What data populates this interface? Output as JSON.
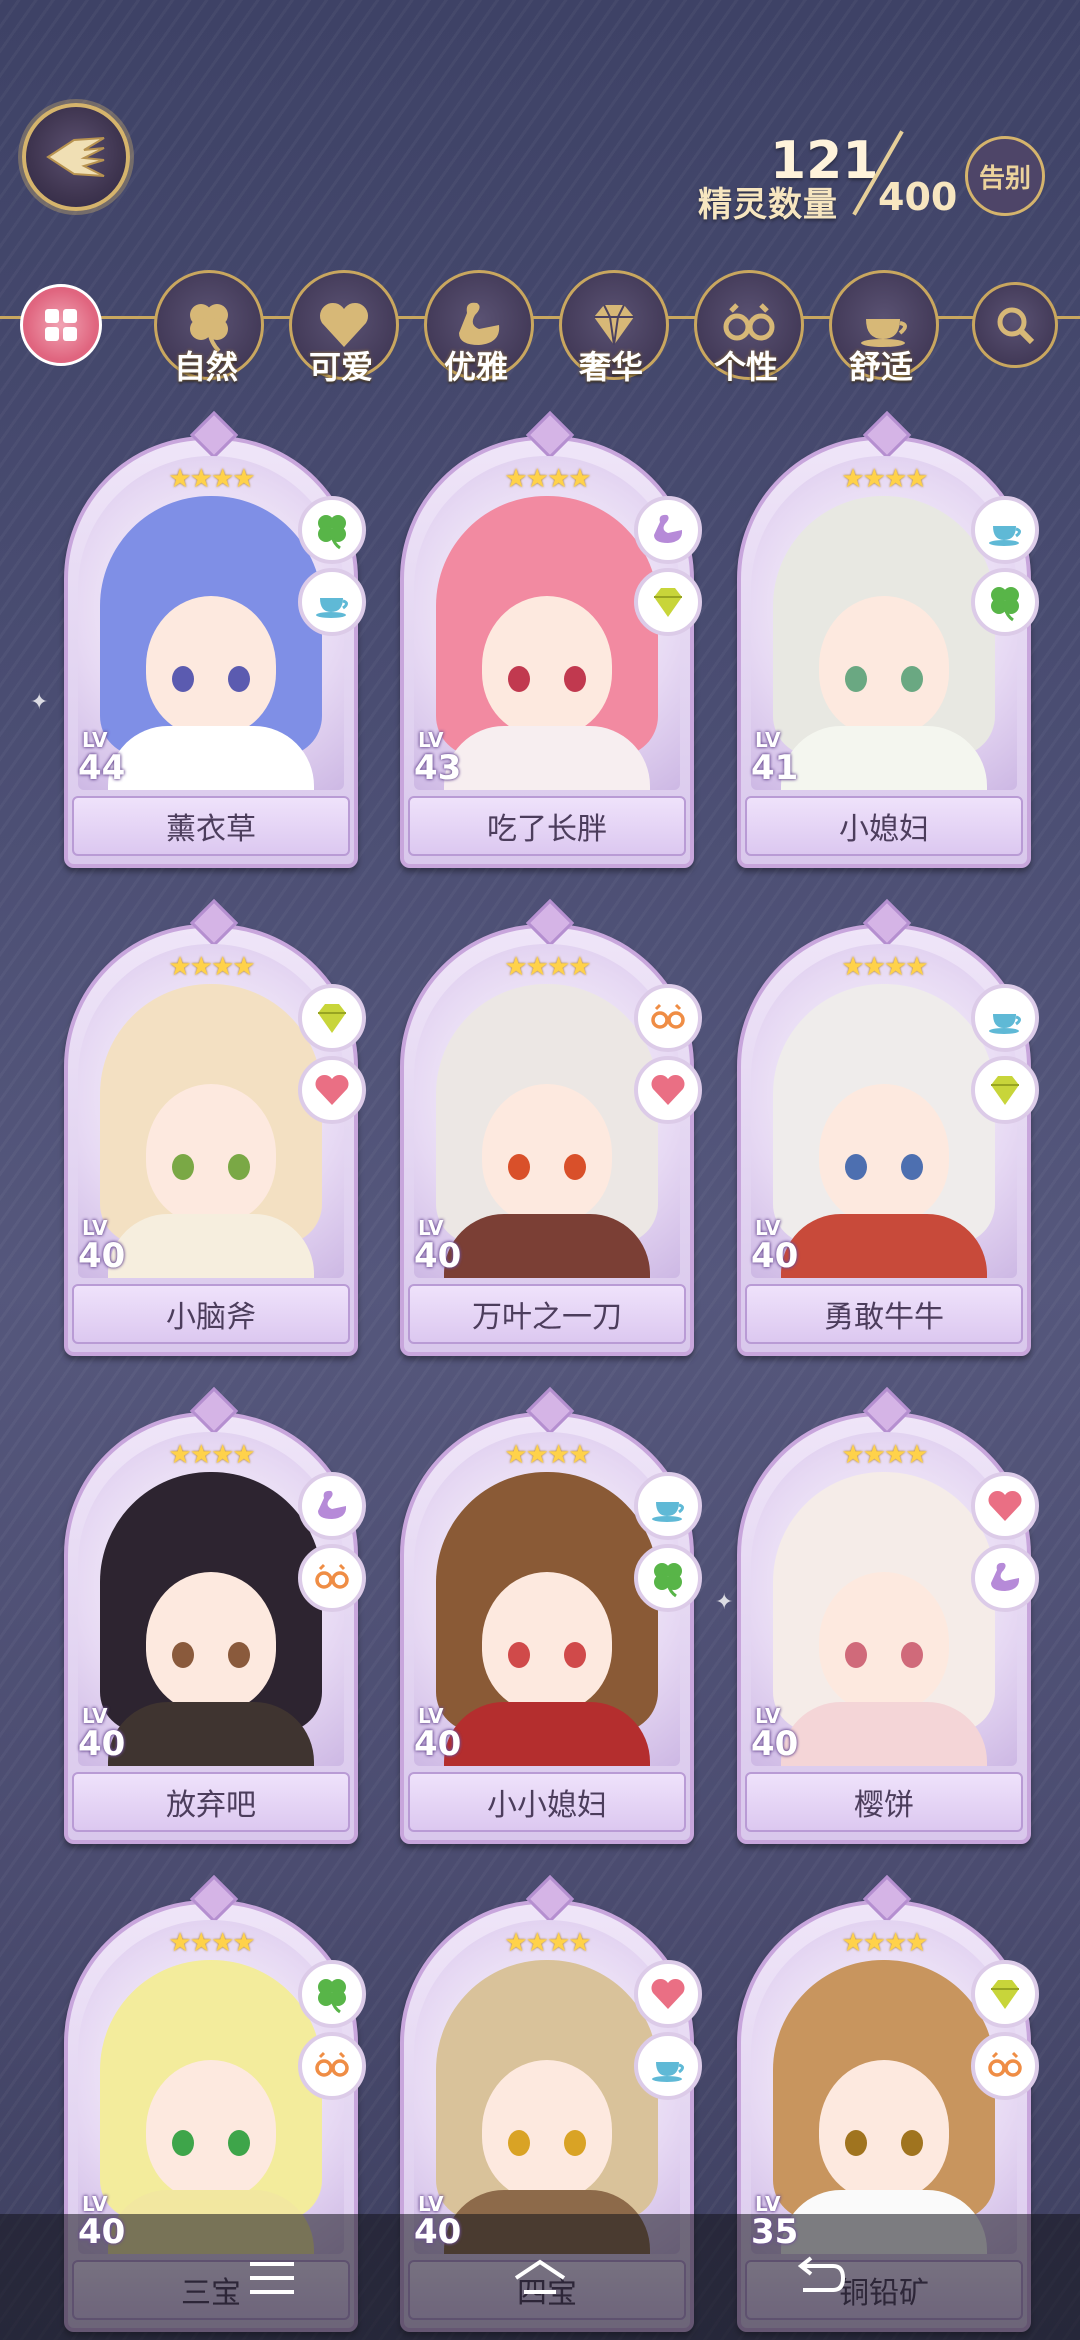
{
  "header": {
    "count_current": "121",
    "count_label": "精灵数量",
    "count_max": "400",
    "farewell_label": "告别"
  },
  "tabs": [
    {
      "label": "",
      "icon": "grid-icon",
      "active": true
    },
    {
      "label": "自然",
      "icon": "clover-icon"
    },
    {
      "label": "可爱",
      "icon": "heart-icon"
    },
    {
      "label": "优雅",
      "icon": "swan-icon"
    },
    {
      "label": "奢华",
      "icon": "diamond-icon"
    },
    {
      "label": "个性",
      "icon": "glasses-icon"
    },
    {
      "label": "舒适",
      "icon": "teacup-icon"
    },
    {
      "label": "",
      "icon": "search-icon"
    }
  ],
  "cards": [
    {
      "name": "薰衣草",
      "lv_label": "LV",
      "level": "44",
      "stars": "★★★★",
      "badges": [
        "clover-icon",
        "teacup-icon"
      ],
      "hair": "#7f8fe6",
      "eyes": "#5b5bb0",
      "outfit": "#ffffff"
    },
    {
      "name": "吃了长胖",
      "lv_label": "LV",
      "level": "43",
      "stars": "★★★★",
      "badges": [
        "swan-icon",
        "diamond-icon"
      ],
      "hair": "#f28aa1",
      "eyes": "#c1394f",
      "outfit": "#f7eef0"
    },
    {
      "name": "小媳妇",
      "lv_label": "LV",
      "level": "41",
      "stars": "★★★★",
      "badges": [
        "teacup-icon",
        "clover-icon"
      ],
      "hair": "#e8e8e2",
      "eyes": "#6aa882",
      "outfit": "#f4f6ef"
    },
    {
      "name": "小脑斧",
      "lv_label": "LV",
      "level": "40",
      "stars": "★★★★",
      "badges": [
        "diamond-icon",
        "heart-icon"
      ],
      "hair": "#f3e0c2",
      "eyes": "#7aa845",
      "outfit": "#f6eede"
    },
    {
      "name": "万叶之一刀",
      "lv_label": "LV",
      "level": "40",
      "stars": "★★★★",
      "badges": [
        "glasses-icon",
        "heart-icon"
      ],
      "hair": "#ece7e4",
      "eyes": "#d9502a",
      "outfit": "#7b3f35"
    },
    {
      "name": "勇敢牛牛",
      "lv_label": "LV",
      "level": "40",
      "stars": "★★★★",
      "badges": [
        "teacup-icon",
        "diamond-icon"
      ],
      "hair": "#efeceb",
      "eyes": "#4d6fb0",
      "outfit": "#c84a3a"
    },
    {
      "name": "放弃吧",
      "lv_label": "LV",
      "level": "40",
      "stars": "★★★★",
      "badges": [
        "swan-icon",
        "glasses-icon"
      ],
      "hair": "#2d2430",
      "eyes": "#8a5a3c",
      "outfit": "#3f3430"
    },
    {
      "name": "小小媳妇",
      "lv_label": "LV",
      "level": "40",
      "stars": "★★★★",
      "badges": [
        "teacup-icon",
        "clover-icon"
      ],
      "hair": "#8a5a36",
      "eyes": "#d04a4a",
      "outfit": "#b42e2e"
    },
    {
      "name": "樱饼",
      "lv_label": "LV",
      "level": "40",
      "stars": "★★★★",
      "badges": [
        "heart-icon",
        "swan-icon"
      ],
      "hair": "#f5ece8",
      "eyes": "#d06a7a",
      "outfit": "#f4d5d7"
    },
    {
      "name": "三宝",
      "lv_label": "LV",
      "level": "40",
      "stars": "★★★★",
      "badges": [
        "clover-icon",
        "glasses-icon"
      ],
      "hair": "#f3ec9c",
      "eyes": "#3ea54a",
      "outfit": "#f2e7a0"
    },
    {
      "name": "四宝",
      "lv_label": "LV",
      "level": "40",
      "stars": "★★★★",
      "badges": [
        "heart-icon",
        "teacup-icon"
      ],
      "hair": "#d9c29a",
      "eyes": "#d9a325",
      "outfit": "#8d6a4a"
    },
    {
      "name": "铜铅矿",
      "lv_label": "LV",
      "level": "35",
      "stars": "★★★★",
      "badges": [
        "diamond-icon",
        "glasses-icon"
      ],
      "hair": "#c8955e",
      "eyes": "#a0741f",
      "outfit": "#fafafa"
    }
  ],
  "colors": {
    "gold": "#c9a75f",
    "card": "#e6d8f3",
    "active_tab": "#e0657f"
  },
  "navbar": {
    "items": [
      "menu-icon",
      "home-icon",
      "back-icon"
    ]
  }
}
